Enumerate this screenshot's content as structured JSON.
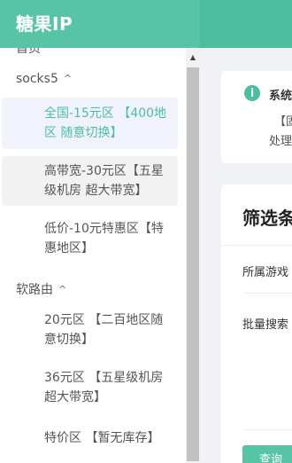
{
  "header": {
    "brand": "糖果IP"
  },
  "sidebar": {
    "cut_item": "首页",
    "groups": [
      {
        "title": "socks5",
        "items": [
          {
            "label": "全国-15元区 【400地区 随意切换】",
            "state": "active"
          },
          {
            "label": "高带宽-30元区【五星级机房 超大带宽】",
            "state": "hover"
          },
          {
            "label": "低价-10元特惠区【特惠地区】",
            "state": "normal"
          }
        ]
      },
      {
        "title": "软路由",
        "items": [
          {
            "label": "20元区 【二百地区随意切换】",
            "state": "normal"
          },
          {
            "label": "36元区 【五星级机房超大带宽】",
            "state": "normal"
          },
          {
            "label": "特价区 【暂无库存】",
            "state": "normal"
          }
        ]
      }
    ]
  },
  "notice": {
    "title": "系统",
    "line1": "【固",
    "line2": "处理"
  },
  "filter": {
    "title": "筛选条",
    "game_label": "所属游戏",
    "batch_label": "批量搜索",
    "query_button": "查询"
  },
  "colors": {
    "accent": "#4cbea0",
    "brand_bg": "#58c4a6"
  },
  "icons": {
    "info": "info-icon",
    "chevron_up": "chevron-up-icon"
  }
}
